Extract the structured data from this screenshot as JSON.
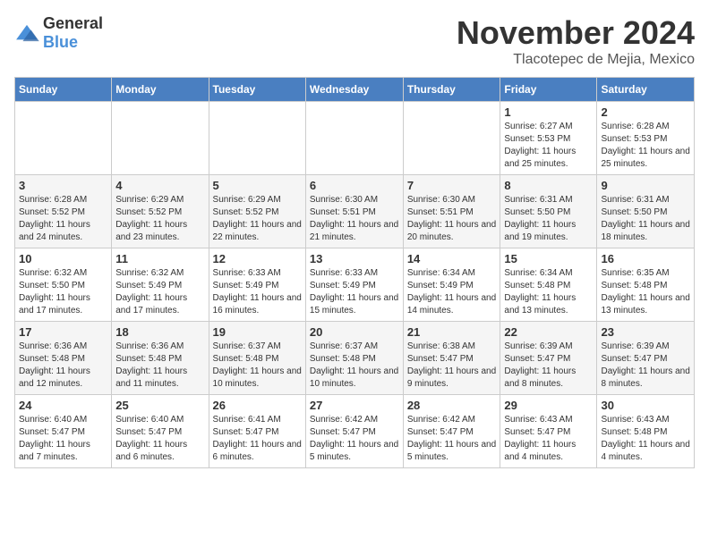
{
  "logo": {
    "text_general": "General",
    "text_blue": "Blue"
  },
  "title": "November 2024",
  "location": "Tlacotepec de Mejia, Mexico",
  "days_of_week": [
    "Sunday",
    "Monday",
    "Tuesday",
    "Wednesday",
    "Thursday",
    "Friday",
    "Saturday"
  ],
  "weeks": [
    [
      {
        "day": "",
        "info": ""
      },
      {
        "day": "",
        "info": ""
      },
      {
        "day": "",
        "info": ""
      },
      {
        "day": "",
        "info": ""
      },
      {
        "day": "",
        "info": ""
      },
      {
        "day": "1",
        "info": "Sunrise: 6:27 AM\nSunset: 5:53 PM\nDaylight: 11 hours and 25 minutes."
      },
      {
        "day": "2",
        "info": "Sunrise: 6:28 AM\nSunset: 5:53 PM\nDaylight: 11 hours and 25 minutes."
      }
    ],
    [
      {
        "day": "3",
        "info": "Sunrise: 6:28 AM\nSunset: 5:52 PM\nDaylight: 11 hours and 24 minutes."
      },
      {
        "day": "4",
        "info": "Sunrise: 6:29 AM\nSunset: 5:52 PM\nDaylight: 11 hours and 23 minutes."
      },
      {
        "day": "5",
        "info": "Sunrise: 6:29 AM\nSunset: 5:52 PM\nDaylight: 11 hours and 22 minutes."
      },
      {
        "day": "6",
        "info": "Sunrise: 6:30 AM\nSunset: 5:51 PM\nDaylight: 11 hours and 21 minutes."
      },
      {
        "day": "7",
        "info": "Sunrise: 6:30 AM\nSunset: 5:51 PM\nDaylight: 11 hours and 20 minutes."
      },
      {
        "day": "8",
        "info": "Sunrise: 6:31 AM\nSunset: 5:50 PM\nDaylight: 11 hours and 19 minutes."
      },
      {
        "day": "9",
        "info": "Sunrise: 6:31 AM\nSunset: 5:50 PM\nDaylight: 11 hours and 18 minutes."
      }
    ],
    [
      {
        "day": "10",
        "info": "Sunrise: 6:32 AM\nSunset: 5:50 PM\nDaylight: 11 hours and 17 minutes."
      },
      {
        "day": "11",
        "info": "Sunrise: 6:32 AM\nSunset: 5:49 PM\nDaylight: 11 hours and 17 minutes."
      },
      {
        "day": "12",
        "info": "Sunrise: 6:33 AM\nSunset: 5:49 PM\nDaylight: 11 hours and 16 minutes."
      },
      {
        "day": "13",
        "info": "Sunrise: 6:33 AM\nSunset: 5:49 PM\nDaylight: 11 hours and 15 minutes."
      },
      {
        "day": "14",
        "info": "Sunrise: 6:34 AM\nSunset: 5:49 PM\nDaylight: 11 hours and 14 minutes."
      },
      {
        "day": "15",
        "info": "Sunrise: 6:34 AM\nSunset: 5:48 PM\nDaylight: 11 hours and 13 minutes."
      },
      {
        "day": "16",
        "info": "Sunrise: 6:35 AM\nSunset: 5:48 PM\nDaylight: 11 hours and 13 minutes."
      }
    ],
    [
      {
        "day": "17",
        "info": "Sunrise: 6:36 AM\nSunset: 5:48 PM\nDaylight: 11 hours and 12 minutes."
      },
      {
        "day": "18",
        "info": "Sunrise: 6:36 AM\nSunset: 5:48 PM\nDaylight: 11 hours and 11 minutes."
      },
      {
        "day": "19",
        "info": "Sunrise: 6:37 AM\nSunset: 5:48 PM\nDaylight: 11 hours and 10 minutes."
      },
      {
        "day": "20",
        "info": "Sunrise: 6:37 AM\nSunset: 5:48 PM\nDaylight: 11 hours and 10 minutes."
      },
      {
        "day": "21",
        "info": "Sunrise: 6:38 AM\nSunset: 5:47 PM\nDaylight: 11 hours and 9 minutes."
      },
      {
        "day": "22",
        "info": "Sunrise: 6:39 AM\nSunset: 5:47 PM\nDaylight: 11 hours and 8 minutes."
      },
      {
        "day": "23",
        "info": "Sunrise: 6:39 AM\nSunset: 5:47 PM\nDaylight: 11 hours and 8 minutes."
      }
    ],
    [
      {
        "day": "24",
        "info": "Sunrise: 6:40 AM\nSunset: 5:47 PM\nDaylight: 11 hours and 7 minutes."
      },
      {
        "day": "25",
        "info": "Sunrise: 6:40 AM\nSunset: 5:47 PM\nDaylight: 11 hours and 6 minutes."
      },
      {
        "day": "26",
        "info": "Sunrise: 6:41 AM\nSunset: 5:47 PM\nDaylight: 11 hours and 6 minutes."
      },
      {
        "day": "27",
        "info": "Sunrise: 6:42 AM\nSunset: 5:47 PM\nDaylight: 11 hours and 5 minutes."
      },
      {
        "day": "28",
        "info": "Sunrise: 6:42 AM\nSunset: 5:47 PM\nDaylight: 11 hours and 5 minutes."
      },
      {
        "day": "29",
        "info": "Sunrise: 6:43 AM\nSunset: 5:47 PM\nDaylight: 11 hours and 4 minutes."
      },
      {
        "day": "30",
        "info": "Sunrise: 6:43 AM\nSunset: 5:48 PM\nDaylight: 11 hours and 4 minutes."
      }
    ]
  ]
}
